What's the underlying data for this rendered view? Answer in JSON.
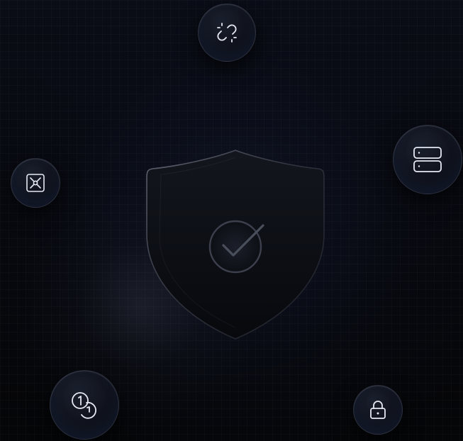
{
  "theme": {
    "background": "#06070b",
    "icon_stroke": "#e6e9f2",
    "node_border": "#3a4156",
    "shield_stroke": "#4a4e5c"
  },
  "center": {
    "icon": "shield-check-icon"
  },
  "nodes": [
    {
      "id": "broken-link",
      "icon": "broken-link-icon"
    },
    {
      "id": "database",
      "icon": "server-database-icon"
    },
    {
      "id": "network",
      "icon": "network-nodes-icon"
    },
    {
      "id": "tokens",
      "icon": "coins-icon"
    },
    {
      "id": "lock",
      "icon": "padlock-icon"
    }
  ]
}
